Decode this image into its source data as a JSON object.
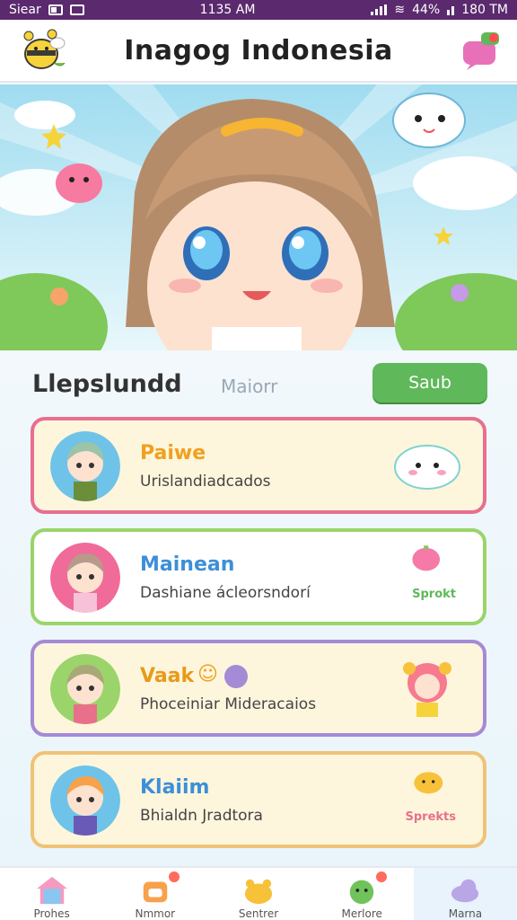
{
  "status_bar": {
    "carrier": "Siear",
    "time": "1135 AM",
    "battery": "44%",
    "extra": "180 TM"
  },
  "header": {
    "title": "Inagog Indonesia"
  },
  "section": {
    "title": "Llepslundd",
    "tab": "Maiorr",
    "search_label": "Saub"
  },
  "cards": [
    {
      "name": "Paiwe",
      "subtitle": "Urislandiadcados",
      "action": "",
      "name_color": "#f0a020",
      "border": "#e86f8f",
      "bg": "#fdf6dc"
    },
    {
      "name": "Mainean",
      "subtitle": "Dashiane ácleorsndorí",
      "action": "Sprokt",
      "name_color": "#3d8fd8",
      "border": "#9bd46a",
      "bg": "#ffffff"
    },
    {
      "name": "Vaak",
      "subtitle": "Phoceiniar Mideracaios",
      "action": "",
      "name_color": "#e89a1a",
      "border": "#a58ad6",
      "bg": "#fdf6dc"
    },
    {
      "name": "Klaiim",
      "subtitle": "Bhialdn Jradtora",
      "action": "Sprekts",
      "name_color": "#3d8fd8",
      "border": "#f0c277",
      "bg": "#fdf6dc"
    }
  ],
  "nav": [
    {
      "label": "Prohes",
      "icon": "house-icon"
    },
    {
      "label": "Nmmor",
      "icon": "mailbox-icon"
    },
    {
      "label": "Sentrer",
      "icon": "pet-icon"
    },
    {
      "label": "Merlore",
      "icon": "apple-icon"
    },
    {
      "label": "Marna",
      "icon": "cloud-icon"
    }
  ]
}
